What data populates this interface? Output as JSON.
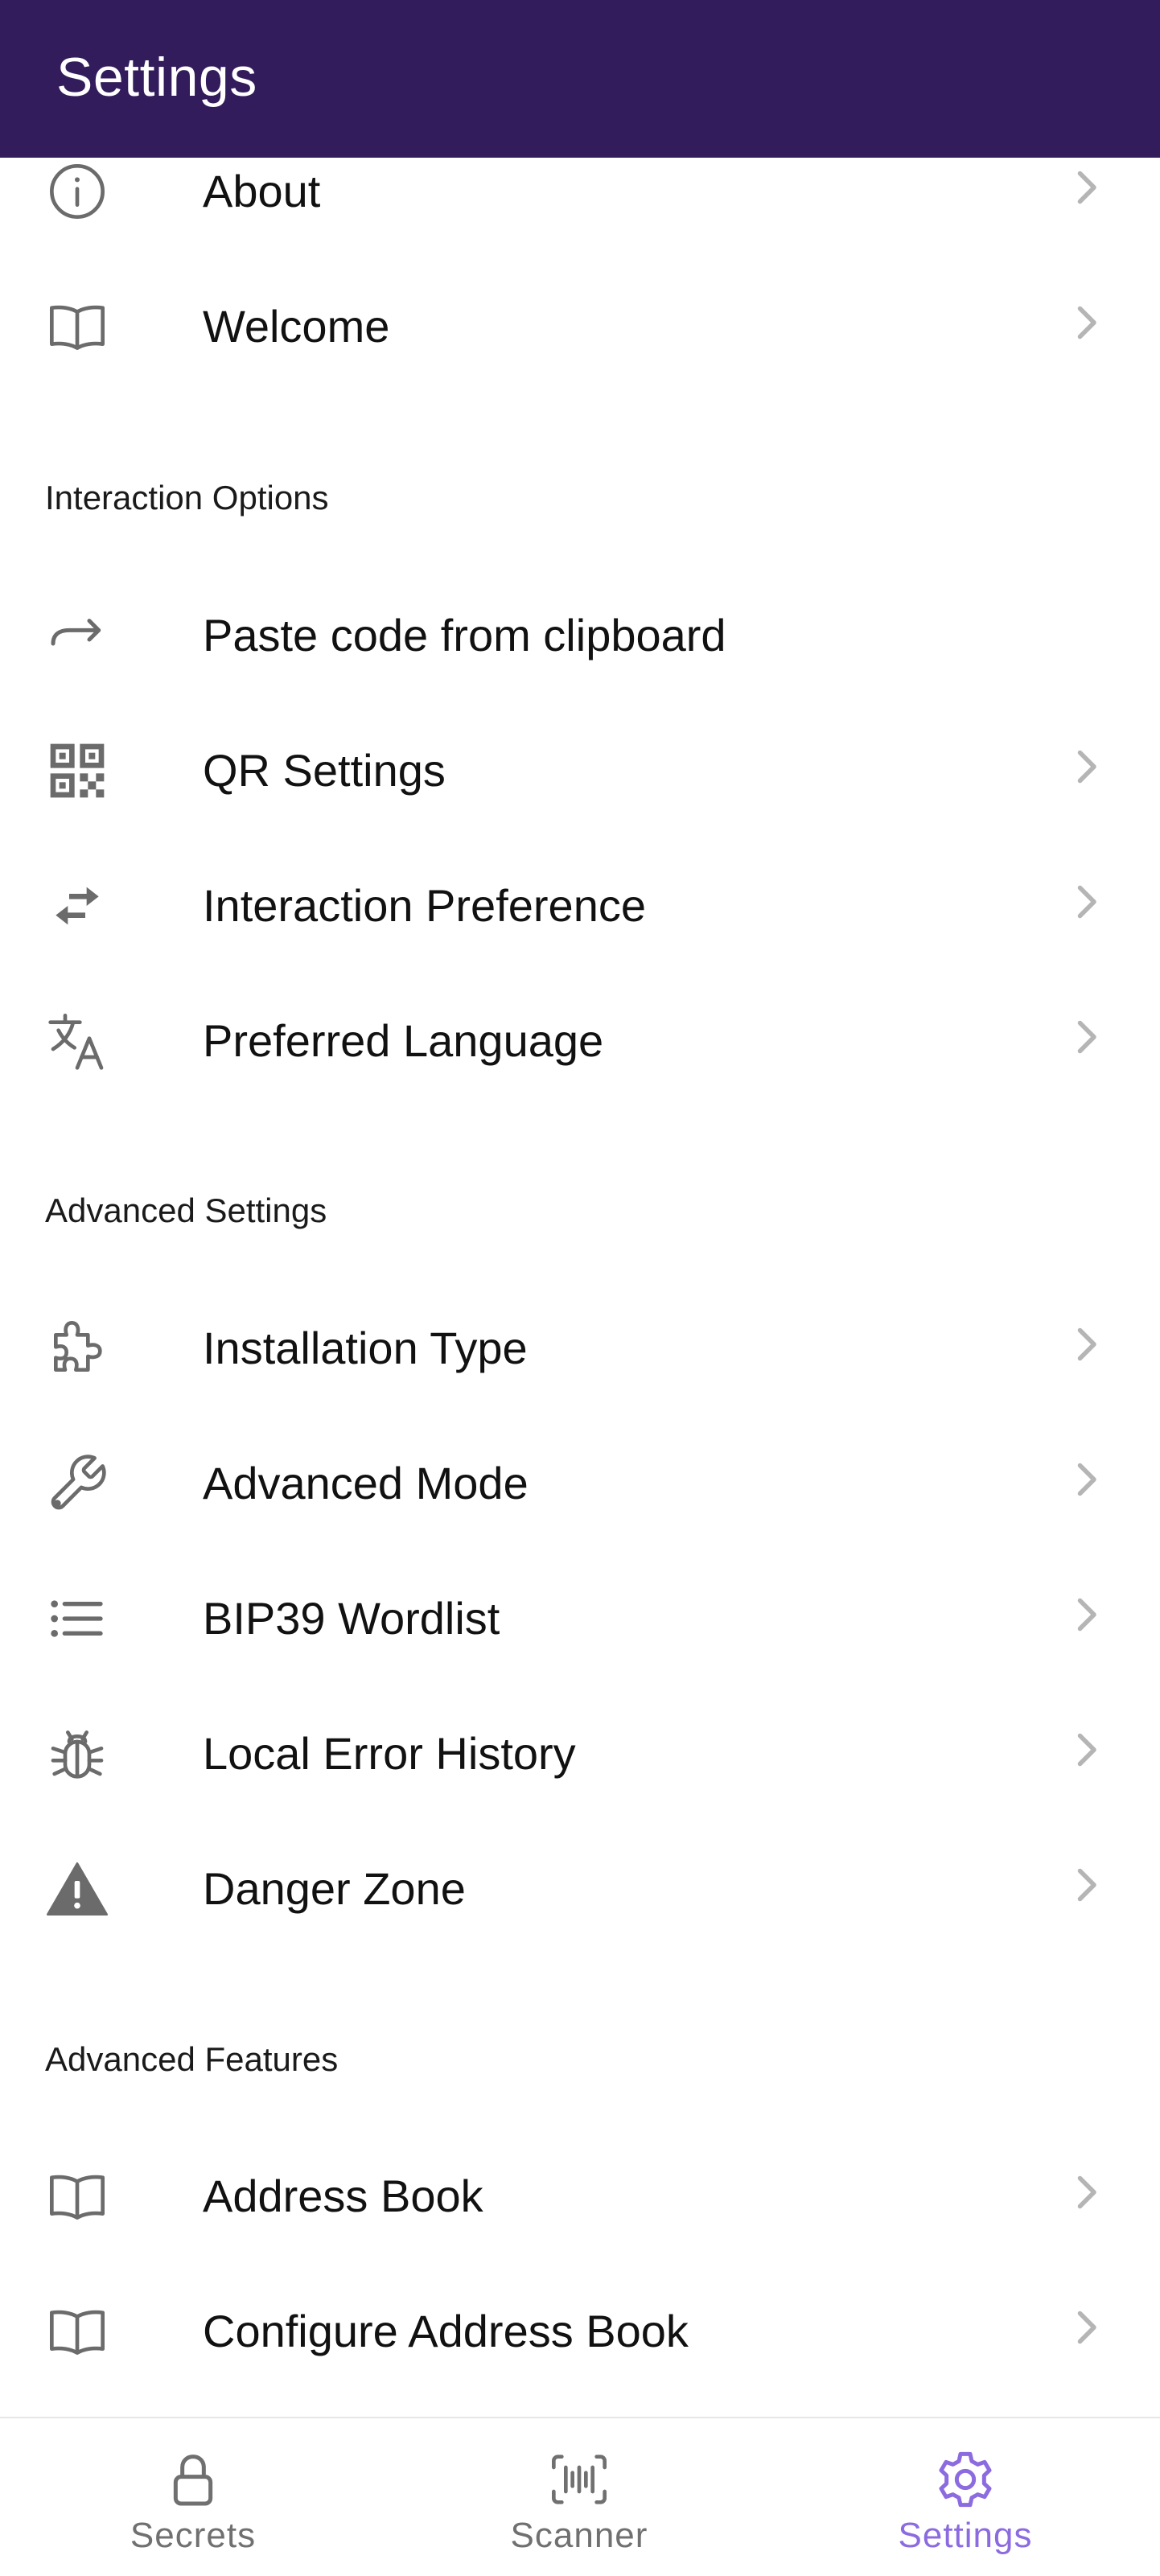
{
  "appbar": {
    "title": "Settings"
  },
  "sections": {
    "interaction_options": "Interaction Options",
    "advanced_settings": "Advanced Settings",
    "advanced_features": "Advanced Features"
  },
  "items": {
    "about": "About",
    "welcome": "Welcome",
    "paste_code": "Paste code from clipboard",
    "qr_settings": "QR Settings",
    "interaction_preference": "Interaction Preference",
    "preferred_language": "Preferred Language",
    "installation_type": "Installation Type",
    "advanced_mode": "Advanced Mode",
    "bip39_wordlist": "BIP39 Wordlist",
    "local_error_history": "Local Error History",
    "danger_zone": "Danger Zone",
    "address_book": "Address Book",
    "configure_address_book": "Configure Address Book"
  },
  "icons": {
    "about": "info-icon",
    "welcome": "book-icon",
    "paste_code": "forward-arrow-icon",
    "qr_settings": "qr-code-icon",
    "interaction_preference": "swap-arrows-icon",
    "preferred_language": "translate-icon",
    "installation_type": "puzzle-icon",
    "advanced_mode": "wrench-icon",
    "bip39_wordlist": "list-icon",
    "local_error_history": "bug-icon",
    "danger_zone": "warning-icon",
    "address_book": "book-icon",
    "configure_address_book": "book-icon",
    "chevron": "chevron-right-icon"
  },
  "bottom_nav": {
    "secrets": "Secrets",
    "scanner": "Scanner",
    "settings": "Settings",
    "active": "settings"
  },
  "colors": {
    "appbar": "#331c5b",
    "icon": "#6b6b6b",
    "chevron": "#b5b5b5",
    "active_tab": "#8c6be0",
    "inactive_tab": "#707070"
  }
}
